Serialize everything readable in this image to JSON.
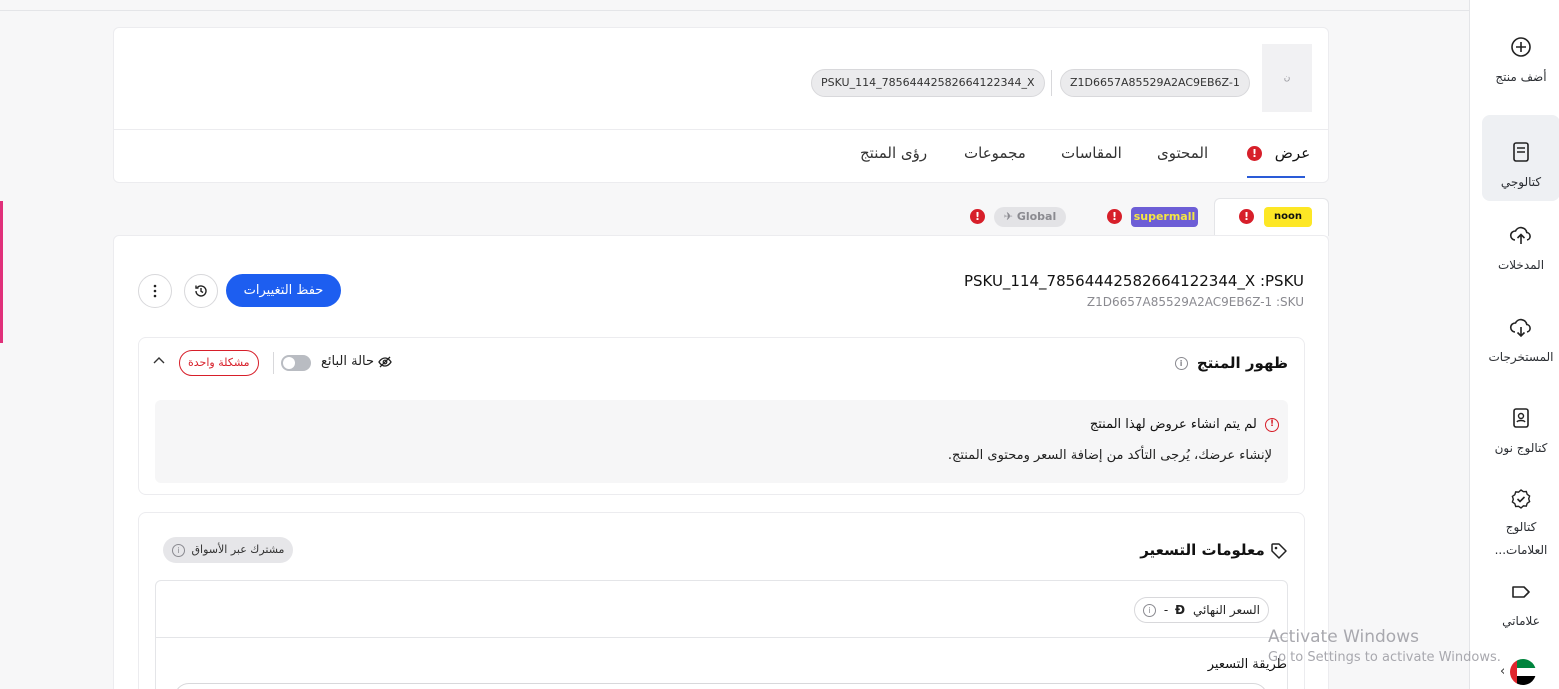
{
  "sidebar": {
    "items": [
      {
        "label": "أضف منتج",
        "icon": "plus-circle-icon"
      },
      {
        "label": "كتالوجي",
        "icon": "book-icon",
        "active": true
      },
      {
        "label": "المدخلات",
        "icon": "cloud-upload-icon"
      },
      {
        "label": "المستخرجات",
        "icon": "cloud-download-icon"
      },
      {
        "label": "كتالوج نون",
        "icon": "book-user-icon"
      },
      {
        "label": "كتالوج العلامات...",
        "icon": "badge-check-icon"
      },
      {
        "label": "علاماتي",
        "icon": "tag-icon"
      }
    ],
    "region_flag": "uae-flag-icon"
  },
  "header": {
    "thumb_text": "ن",
    "sku_chip": "Z1D6657A85529A2AC9EB6Z-1",
    "psku_chip": "PSKU_114_78564442582664122344_X",
    "tabs": [
      "عرض",
      "المحتوى",
      "المقاسات",
      "مجموعات",
      "رؤى المنتج"
    ],
    "active_tab": "عرض"
  },
  "marketplaces": {
    "noon": "noon",
    "supermall": "supermall",
    "global": "Global",
    "error_mark": "!"
  },
  "product": {
    "psku_line": "PSKU_114_78564442582664122344_X :PSKU",
    "sku_line": "Z1D6657A85529A2AC9EB6Z-1 :SKU",
    "save_label": "حفظ التغييرات"
  },
  "visibility": {
    "title": "ظهور المنتج",
    "seller_status_label": "حالة البائع",
    "issue_badge": "مشكلة واحدة",
    "notice_title": "لم يتم انشاء عروض لهذا المنتج",
    "notice_body": "لإنشاء عرضك، يُرجى التأكد من إضافة السعر ومحتوى المنتج."
  },
  "pricing": {
    "title": "معلومات التسعير",
    "shared_chip": "مشترك عبر الأسواق",
    "final_price_label": "السعر النهائي",
    "final_price_value": "-",
    "currency_symbol": "Đ",
    "method_label": "طريقة التسعير"
  },
  "watermark": {
    "line1": "Activate Windows",
    "line2": "Go to Settings to activate Windows."
  },
  "colors": {
    "accent": "#1d5ef0",
    "error": "#d71f2a",
    "noon_yellow": "#fde725",
    "supermall_purple": "#6d5ed6"
  }
}
